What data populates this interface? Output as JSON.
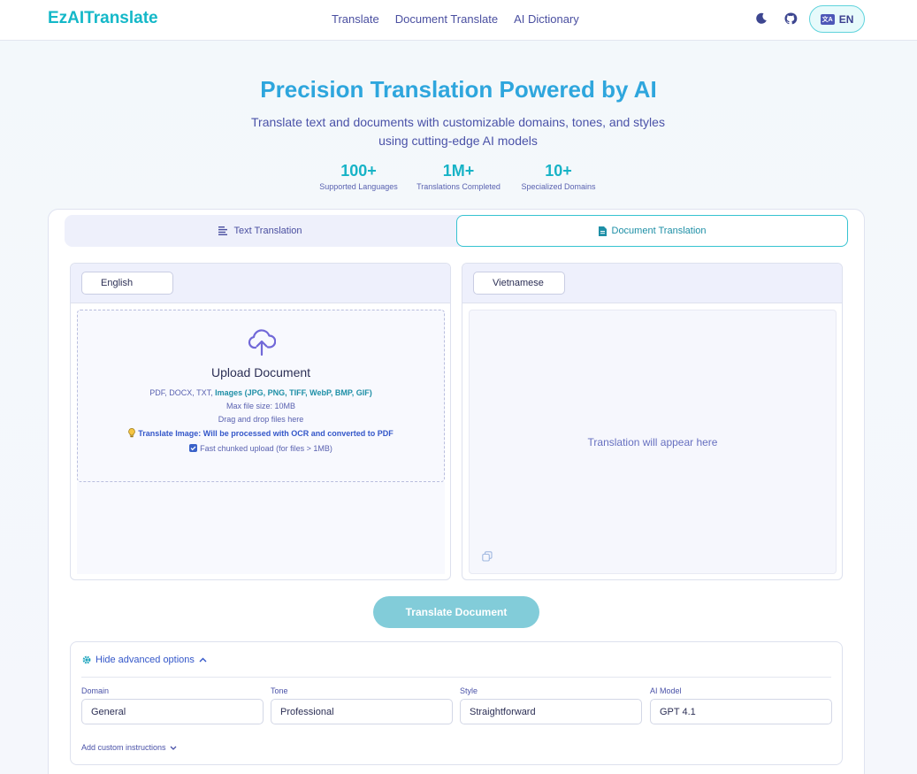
{
  "header": {
    "logo": "EzAITranslate",
    "nav": [
      "Translate",
      "Document Translate",
      "AI Dictionary"
    ],
    "language_badge": "文A",
    "language_code": "EN"
  },
  "hero": {
    "title": "Precision Translation Powered by AI",
    "subtitle_line1": "Translate text and documents with customizable domains, tones, and styles",
    "subtitle_line2": "using cutting-edge AI models",
    "stats": [
      {
        "value": "100+",
        "label": "Supported Languages"
      },
      {
        "value": "1M+",
        "label": "Translations Completed"
      },
      {
        "value": "10+",
        "label": "Specialized Domains"
      }
    ]
  },
  "tabs": {
    "text": "Text Translation",
    "document": "Document Translation"
  },
  "source": {
    "language": "English",
    "upload_title": "Upload Document",
    "formats_plain": "PDF, DOCX, TXT, ",
    "formats_images": "Images (JPG, PNG, TIFF, WebP, BMP, GIF)",
    "max_size": "Max file size: 10MB",
    "drag_drop": "Drag and drop files here",
    "ocr_note": "Translate Image: Will be processed with OCR and converted to PDF",
    "chunked_upload": "Fast chunked upload (for files > 1MB)"
  },
  "target": {
    "language": "Vietnamese",
    "placeholder": "Translation will appear here"
  },
  "translate_button": "Translate Document",
  "advanced": {
    "toggle": "Hide advanced options",
    "domain_label": "Domain",
    "domain_value": "General",
    "tone_label": "Tone",
    "tone_value": "Professional",
    "style_label": "Style",
    "style_value": "Straightforward",
    "model_label": "AI Model",
    "model_value": "GPT 4.1",
    "custom_instructions": "Add custom instructions"
  },
  "colors": {
    "accent_teal": "#14b8c8",
    "primary_indigo": "#4a4fa0",
    "button_disabled": "#82ccd9"
  },
  "icons": [
    "moon-icon",
    "github-icon",
    "translate-icon",
    "lines-icon",
    "document-icon",
    "cloud-upload-icon",
    "lightbulb-icon",
    "checkbox-icon",
    "copy-icon",
    "gear-icon",
    "chevron-up-icon",
    "chevron-down-icon"
  ]
}
